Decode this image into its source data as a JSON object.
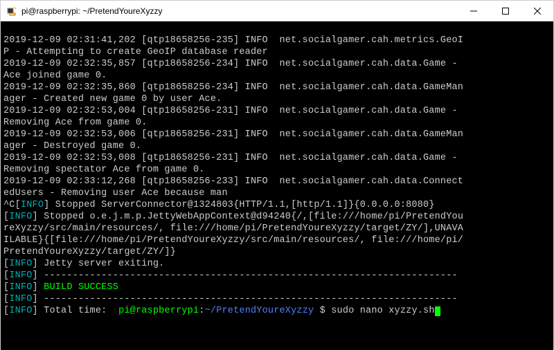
{
  "window": {
    "title": "pi@raspberrypi: ~/PretendYoureXyzzy"
  },
  "log": {
    "l1a": "2019-12-09 02:31:41,202 [qtp18658256-235] INFO  net.socialgamer.cah.metrics.GeoI",
    "l1b": "P - Attempting to create GeoIP database reader",
    "l2a": "2019-12-09 02:32:35,857 [qtp18658256-234] INFO  net.socialgamer.cah.data.Game - ",
    "l2b": "Ace joined game 0.",
    "l3a": "2019-12-09 02:32:35,860 [qtp18658256-234] INFO  net.socialgamer.cah.data.GameMan",
    "l3b": "ager - Created new game 0 by user Ace.",
    "l4a": "2019-12-09 02:32:53,004 [qtp18658256-231] INFO  net.socialgamer.cah.data.Game - ",
    "l4b": "Removing Ace from game 0.",
    "l5a": "2019-12-09 02:32:53,006 [qtp18658256-231] INFO  net.socialgamer.cah.data.GameMan",
    "l5b": "ager - Destroyed game 0.",
    "l6a": "2019-12-09 02:32:53,008 [qtp18658256-231] INFO  net.socialgamer.cah.data.Game - ",
    "l6b": "Removing spectator Ace from game 0.",
    "l7a": "2019-12-09 02:33:12,268 [qtp18658256-233] INFO  net.socialgamer.cah.data.Connect",
    "l7b": "edUsers - Removing user Ace because man",
    "int1": "^C",
    "intInfo": "INFO",
    "int1b": " Stopped ServerConnector@1324803{HTTP/1.1,[http/1.1]}{0.0.0.0:8080}",
    "ctx1": " Stopped o.e.j.m.p.JettyWebAppContext@d94240{/,[file:///home/pi/PretendYou",
    "ctx2": "reXyzzy/src/main/resources/, file:///home/pi/PretendYoureXyzzy/target/ZY/],UNAVA",
    "ctx3": "ILABLE}{[file:///home/pi/PretendYoureXyzzy/src/main/resources/, file:///home/pi/",
    "ctx4": "PretendYoureXyzzy/target/ZY/]}",
    "exit": " Jetty server exiting.",
    "dashes": " ------------------------------------------------------------------------",
    "build": " BUILD SUCCESS",
    "total": " Total time:  ",
    "prompt_user": "pi@raspberrypi",
    "prompt_colon": ":",
    "prompt_path": "~/PretendYoureXyzzy",
    "prompt_sym": " $ ",
    "command": "sudo nano xyzzy.sh",
    "bracket_open": "[",
    "bracket_close": "]"
  }
}
